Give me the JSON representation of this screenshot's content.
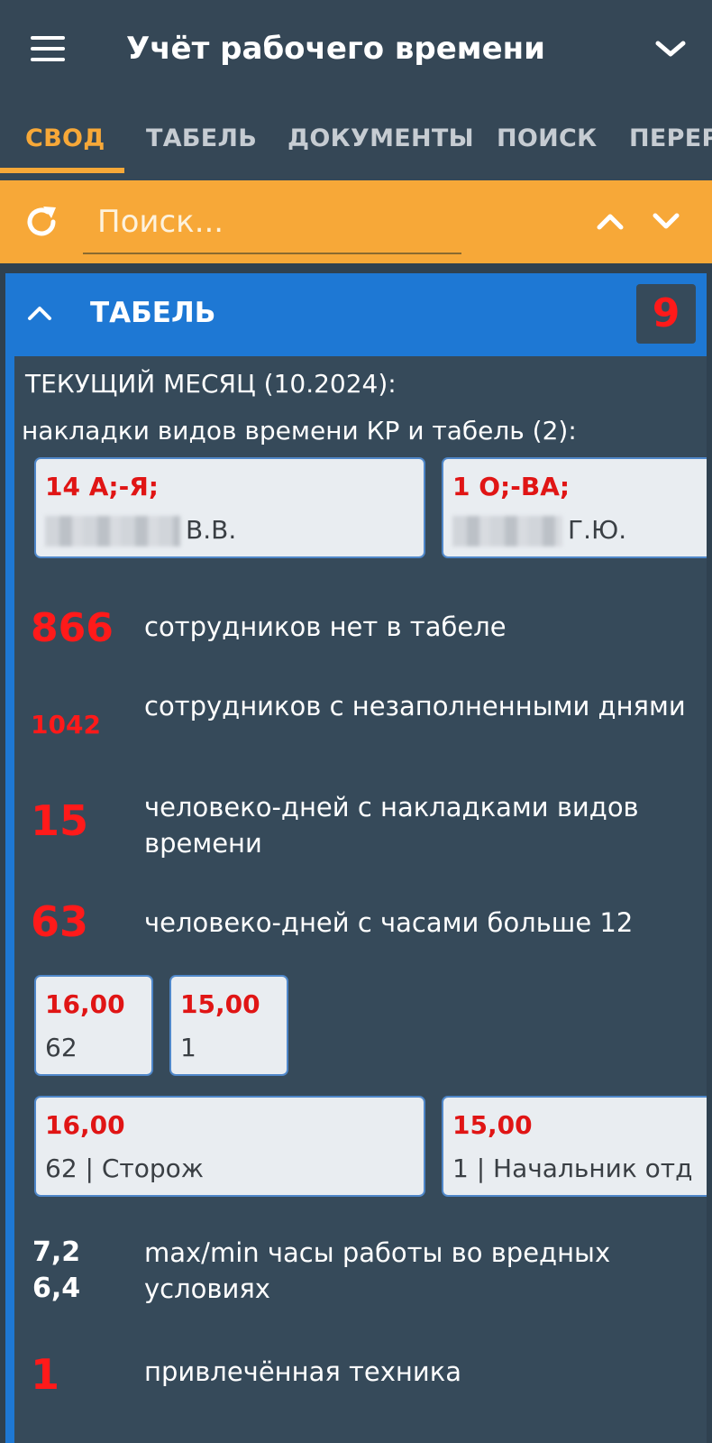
{
  "app": {
    "title": "Учёт рабочего времени"
  },
  "tabs": [
    {
      "label": "СВОД",
      "active": true
    },
    {
      "label": "ТАБЕЛЬ",
      "active": false
    },
    {
      "label": "ДОКУМЕНТЫ",
      "active": false
    },
    {
      "label": "ПОИСК",
      "active": false
    },
    {
      "label": "ПЕРЕР",
      "active": false
    }
  ],
  "search": {
    "placeholder": "Поиск..."
  },
  "panel": {
    "title": "ТАБЕЛЬ",
    "badge": "9",
    "month_line": "ТЕКУЩИЙ МЕСЯЦ (10.2024):",
    "overlays_line": "накладки видов времени КР и табель (2):",
    "overlay_cards": [
      {
        "code": "14 А;-Я;",
        "initials": "В.В."
      },
      {
        "code": "1 О;-ВА;",
        "initials": "Г.Ю."
      }
    ],
    "stats": [
      {
        "value": "866",
        "text": "сотрудников нет в табеле"
      },
      {
        "value": "1042",
        "text": "сотрудников с незаполненными днями"
      },
      {
        "value": "15",
        "text": "человеко-дней с накладками видов времени"
      },
      {
        "value": "63",
        "text": "человеко-дней с часами больше 12"
      }
    ],
    "hour_cards_small": [
      {
        "hours": "16,00",
        "count": "62"
      },
      {
        "hours": "15,00",
        "count": "1"
      }
    ],
    "hour_cards_wide": [
      {
        "hours": "16,00",
        "detail": "62 | Сторож"
      },
      {
        "hours": "15,00",
        "detail": "1 | Начальник отд"
      }
    ],
    "harmful": {
      "max": "7,2",
      "min": "6,4",
      "text": "max/min часы работы во вредных условиях"
    },
    "equipment": {
      "value": "1",
      "text": "привлечённая техника"
    }
  },
  "colors": {
    "header": "#354756",
    "accent": "#f7a838",
    "panel_blue": "#1e78d4",
    "alert_red": "#ff1a1a"
  },
  "icons": [
    "menu-icon",
    "chevron-down-icon",
    "refresh-icon",
    "chevron-up-icon"
  ]
}
